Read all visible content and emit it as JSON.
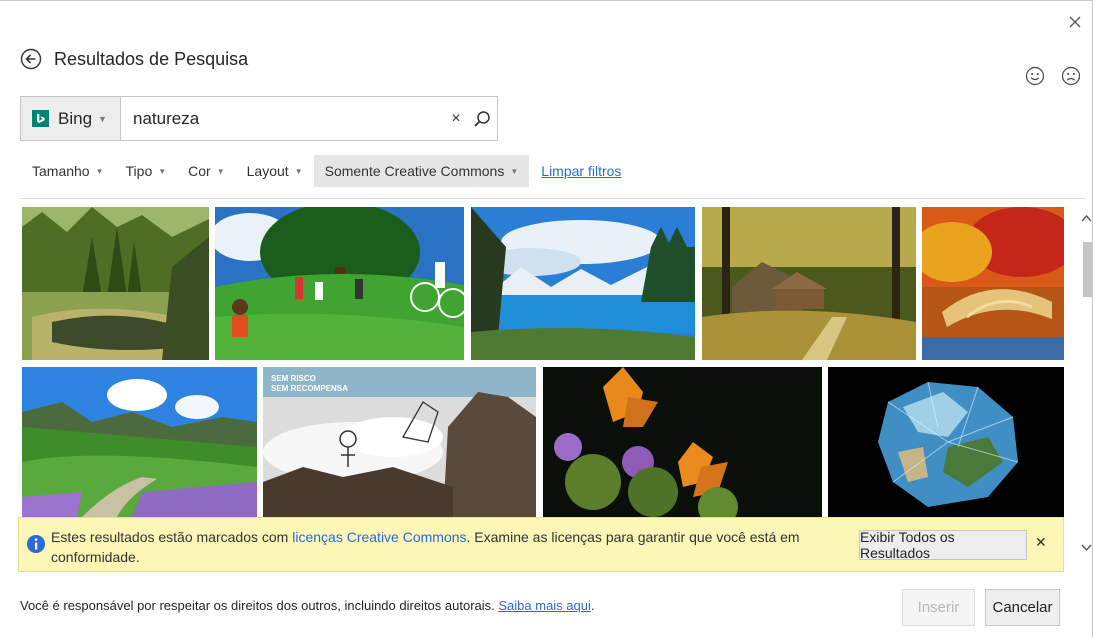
{
  "dialog": {
    "title": "Resultados de Pesquisa"
  },
  "search": {
    "engine_label": "Bing",
    "query": "natureza"
  },
  "filters": {
    "items": [
      {
        "label": "Tamanho"
      },
      {
        "label": "Tipo"
      },
      {
        "label": "Cor"
      },
      {
        "label": "Layout"
      },
      {
        "label": "Somente Creative Commons"
      }
    ],
    "clear_label": "Limpar filtros"
  },
  "results": {
    "images": [
      {
        "icon": "lake-forest-image"
      },
      {
        "icon": "people-park-image"
      },
      {
        "icon": "mountain-lake-image"
      },
      {
        "icon": "forest-cabin-image"
      },
      {
        "icon": "autumn-bridge-image"
      },
      {
        "icon": "mountain-valley-flowers-image"
      },
      {
        "icon": "cartoon-cliff-image"
      },
      {
        "icon": "butterflies-thistle-image"
      },
      {
        "icon": "crumpled-globe-image"
      }
    ],
    "cartoon_caption_1": "SEM RISCO",
    "cartoon_caption_2": "SEM RECOMPENSA"
  },
  "notice": {
    "text_before": "Estes resultados estão marcados com ",
    "link": "licenças Creative Commons",
    "text_after": ". Examine as licenças para garantir que você está em conformidade.",
    "show_all_label": "Exibir Todos os Resultados"
  },
  "footer": {
    "text": "Você é responsável por respeitar os direitos dos outros, incluindo direitos autorais. ",
    "link": "Saiba mais aqui",
    "period": ".",
    "insert_label": "Inserir",
    "cancel_label": "Cancelar"
  },
  "colors": {
    "bing": "#008373",
    "link": "#2b6bd8",
    "notice_bg": "#fcf7b6"
  }
}
